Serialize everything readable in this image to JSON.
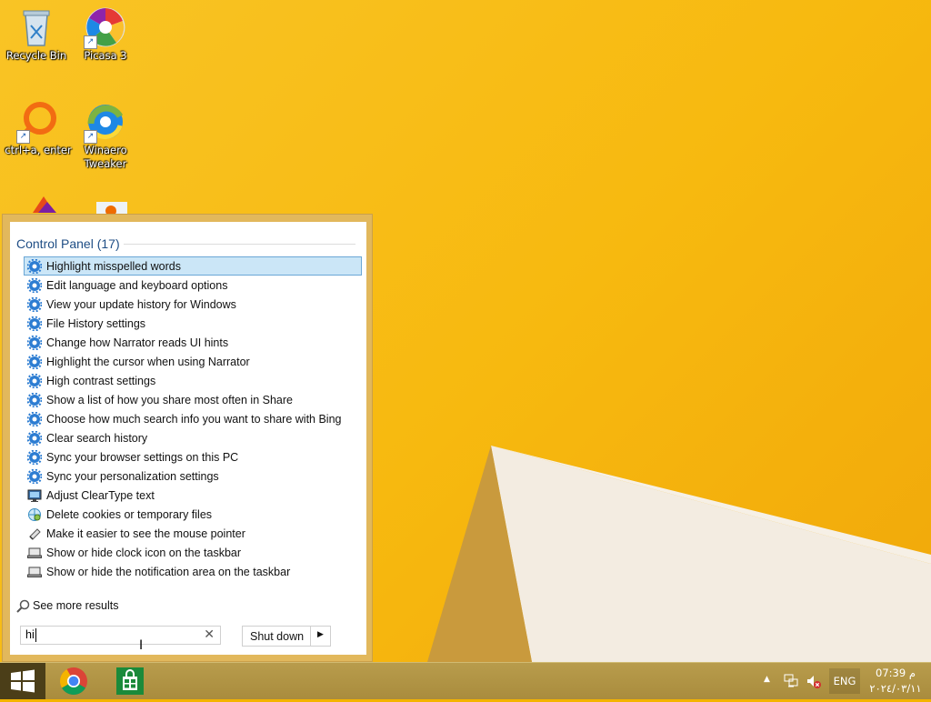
{
  "desktop": {
    "icons": [
      {
        "label": "Recycle Bin"
      },
      {
        "label": "Picasa 3"
      },
      {
        "label": "ctrl+a, enter"
      },
      {
        "label": "Winaero Tweaker"
      }
    ],
    "shortcut_glyph": "↗"
  },
  "results": {
    "title": "Control Panel (17)",
    "items": [
      {
        "label": "Highlight misspelled words",
        "icon": "gear-icon"
      },
      {
        "label": "Edit language and keyboard options",
        "icon": "gear-icon"
      },
      {
        "label": "View your update history for Windows",
        "icon": "gear-icon"
      },
      {
        "label": "File History settings",
        "icon": "gear-icon"
      },
      {
        "label": "Change how Narrator reads UI hints",
        "icon": "gear-icon"
      },
      {
        "label": "Highlight the cursor when using Narrator",
        "icon": "gear-icon"
      },
      {
        "label": "High contrast settings",
        "icon": "gear-icon"
      },
      {
        "label": "Show a list of how you share most often in Share",
        "icon": "gear-icon"
      },
      {
        "label": "Choose how much search info you want to share with Bing",
        "icon": "gear-icon"
      },
      {
        "label": "Clear search history",
        "icon": "gear-icon"
      },
      {
        "label": "Sync your browser settings on this PC",
        "icon": "gear-icon"
      },
      {
        "label": "Sync your personalization settings",
        "icon": "gear-icon"
      },
      {
        "label": "Adjust ClearType text",
        "icon": "monitor-icon"
      },
      {
        "label": "Delete cookies or temporary files",
        "icon": "internet-options-icon"
      },
      {
        "label": "Make it easier to see the mouse pointer",
        "icon": "mouse-pointer-icon"
      },
      {
        "label": "Show or hide clock icon on the taskbar",
        "icon": "laptop-icon"
      },
      {
        "label": "Show or hide the notification area on the taskbar",
        "icon": "laptop-icon"
      }
    ],
    "see_more": "See more results"
  },
  "search": {
    "value": "hi",
    "clear_glyph": "✕"
  },
  "shutdown": {
    "label": "Shut down",
    "arrow_glyph": "▶"
  },
  "taskbar": {
    "apps": [
      "Google Chrome",
      "Windows Store"
    ],
    "tray": {
      "show_hidden_glyph": "▲",
      "language": "ENG",
      "time": "07:39 م",
      "date": "٢٠٢٤/٠٣/١١"
    }
  },
  "colors": {
    "desktop": "#f7b90f",
    "selection": "#cbe6f7",
    "accent_blue": "#1f4e85",
    "taskbar": "#b09445"
  }
}
